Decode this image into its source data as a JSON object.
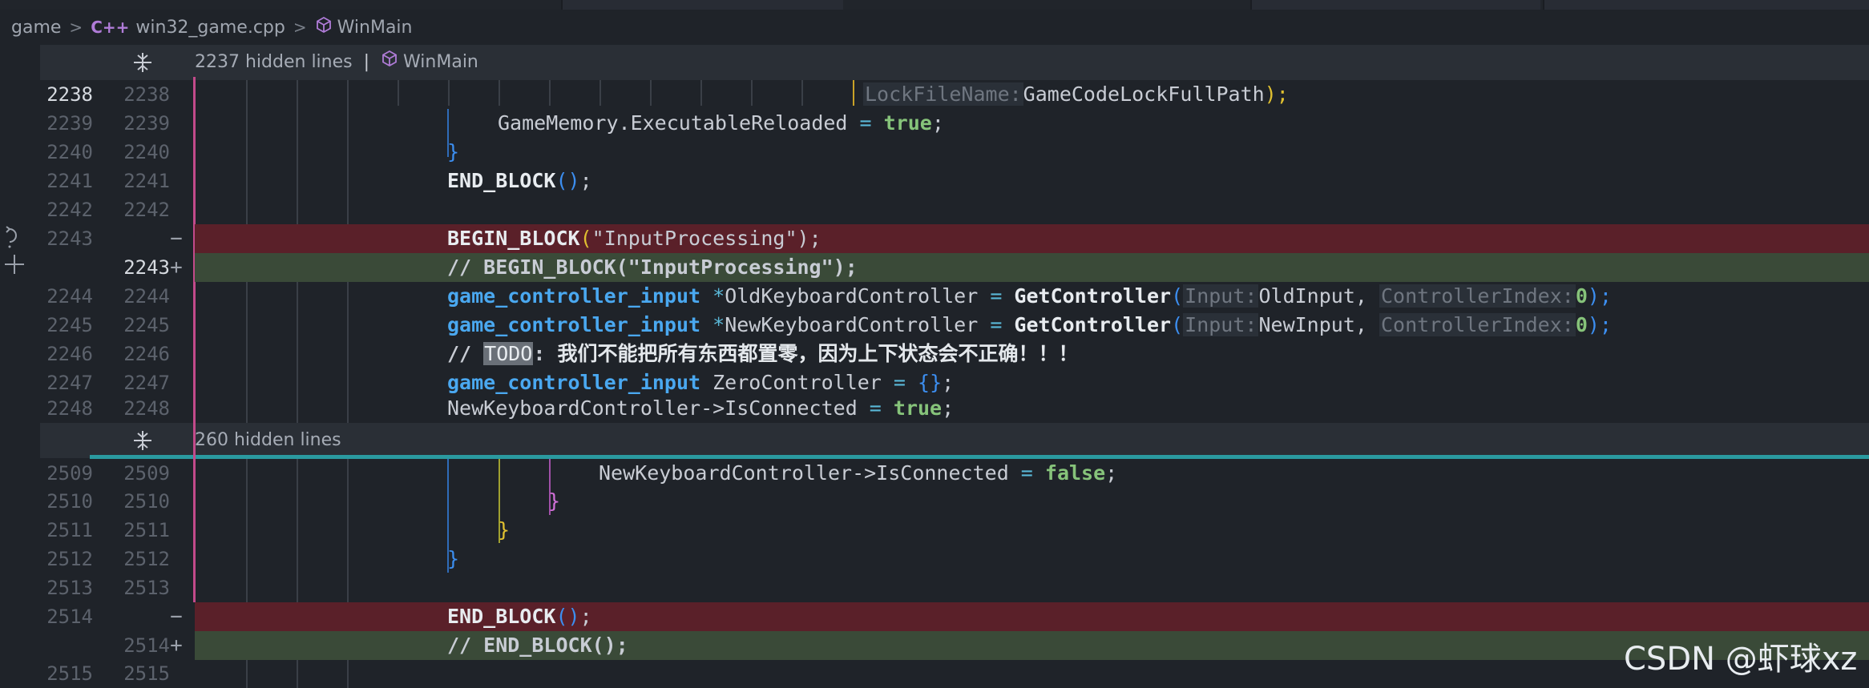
{
  "breadcrumb": {
    "folder": "game",
    "file_icon": "C++",
    "file": "win32_game.cpp",
    "symbol": "WinMain"
  },
  "fold_top": {
    "hidden": "2237 hidden lines",
    "sep": "|",
    "symbol": "WinMain"
  },
  "fold_mid": {
    "hidden": "260 hidden lines"
  },
  "lines": {
    "l2238": {
      "left": "2238",
      "right": "2238",
      "hint": "LockFileName:",
      "arg": "GameCodeLockFullPath",
      "tail": ");"
    },
    "l2239": {
      "left": "2239",
      "right": "2239",
      "obj": "GameMemory.ExecutableReloaded",
      "eq": " = ",
      "val": "true",
      "semi": ";"
    },
    "l2240": {
      "left": "2240",
      "right": "2240",
      "brace": "}"
    },
    "l2241": {
      "left": "2241",
      "right": "2241",
      "fn": "END_BLOCK",
      "paren": "()",
      "semi": ";"
    },
    "l2242": {
      "left": "2242",
      "right": "2242"
    },
    "l2243d": {
      "left": "2243",
      "marker": "−",
      "fn": "BEGIN_BLOCK",
      "open": "(",
      "str": "\"InputProcessing\"",
      "close": ");"
    },
    "l2243a": {
      "right": "2243",
      "marker": "+",
      "text": "// BEGIN_BLOCK(\"InputProcessing\");"
    },
    "l2244": {
      "left": "2244",
      "right": "2244",
      "type": "game_controller_input",
      "star": " *",
      "var": "OldKeyboardController",
      "eq": " = ",
      "fn": "GetController",
      "open": "(",
      "hint1": "Input:",
      "arg1": "OldInput, ",
      "hint2": "ControllerIndex:",
      "num": "0",
      "close": ");"
    },
    "l2245": {
      "left": "2245",
      "right": "2245",
      "type": "game_controller_input",
      "star": " *",
      "var": "NewKeyboardController",
      "eq": " = ",
      "fn": "GetController",
      "open": "(",
      "hint1": "Input:",
      "arg1": "NewInput, ",
      "hint2": "ControllerIndex:",
      "num": "0",
      "close": ");"
    },
    "l2246": {
      "left": "2246",
      "right": "2246",
      "slash": "// ",
      "todo": "TODO",
      "colon": ": ",
      "cjk": "我们不能把所有东西都置零，因为上下状态会不正确！！！"
    },
    "l2247": {
      "left": "2247",
      "right": "2247",
      "type": "game_controller_input",
      "var": " ZeroController",
      "eq": " = ",
      "braces": "{}",
      "semi": ";"
    },
    "l2248": {
      "left": "2248",
      "right": "2248",
      "obj": "NewKeyboardController->IsConnected",
      "eq": " = ",
      "val": "true",
      "semi": ";"
    },
    "l2509": {
      "left": "2509",
      "right": "2509",
      "obj": "NewKeyboardController->IsConnected",
      "eq": " = ",
      "val": "false",
      "semi": ";"
    },
    "l2510": {
      "left": "2510",
      "right": "2510",
      "brace": "}"
    },
    "l2511": {
      "left": "2511",
      "right": "2511",
      "brace": "}"
    },
    "l2512": {
      "left": "2512",
      "right": "2512",
      "brace": "}"
    },
    "l2513": {
      "left": "2513",
      "right": "2513"
    },
    "l2514d": {
      "left": "2514",
      "marker": "−",
      "fn": "END_BLOCK",
      "paren": "()",
      "semi": ";"
    },
    "l2514a": {
      "right": "2514",
      "marker": "+",
      "text": "// END_BLOCK();"
    },
    "l2515": {
      "left": "2515",
      "right": "2515"
    }
  },
  "watermark": "CSDN @虾球xz",
  "icons": [
    "chevron-right-icon",
    "cube-icon",
    "fold-icon",
    "revert-icon",
    "plus-icon"
  ]
}
